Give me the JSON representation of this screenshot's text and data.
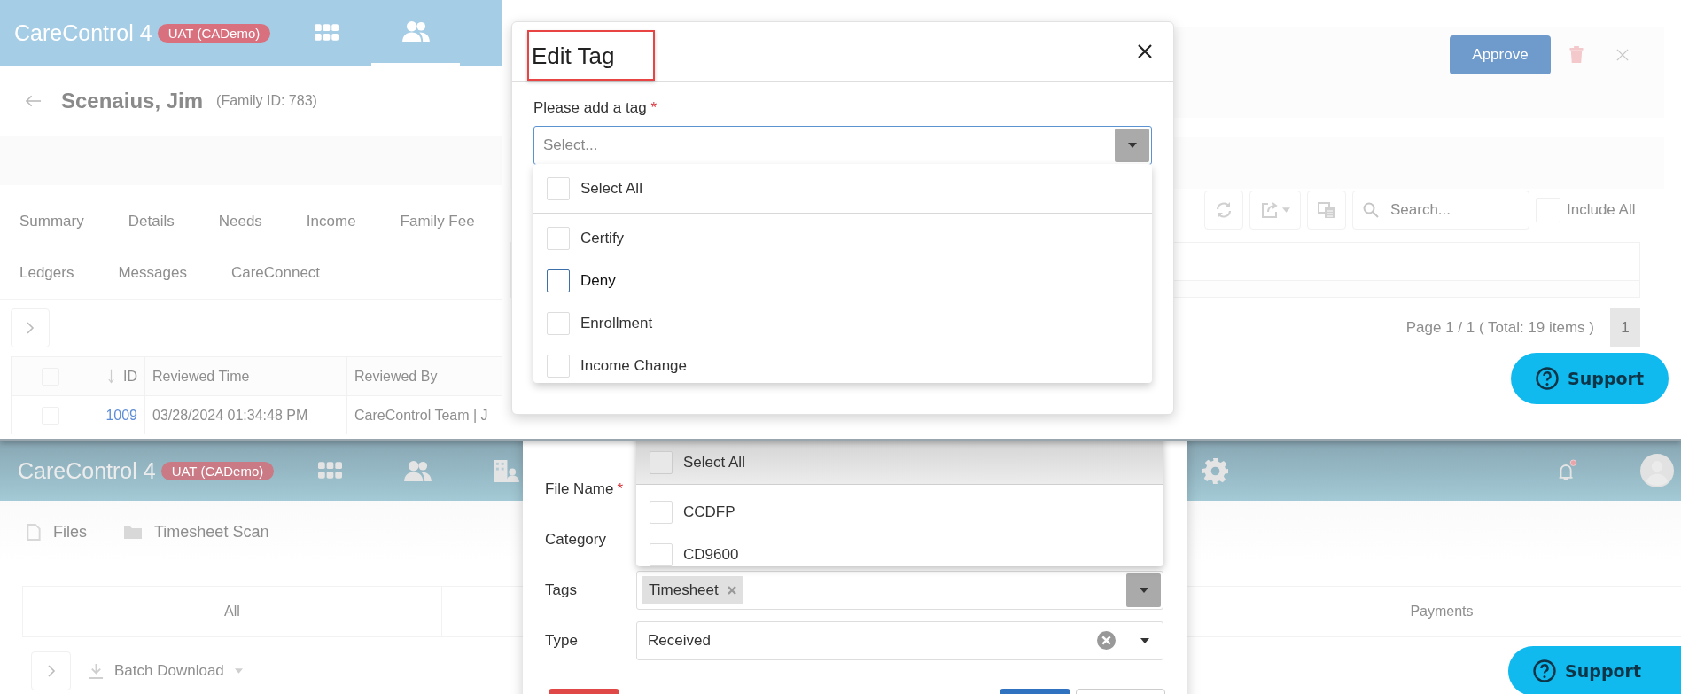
{
  "top_screen": {
    "app_bar": {
      "title": "CareControl 4",
      "environment": "UAT (CADemo)"
    },
    "person": {
      "name": "Scenaius, Jim",
      "family_id": "(Family ID: 783)"
    },
    "tab_rows": [
      [
        "Summary",
        "Details",
        "Needs",
        "Income",
        "Family Fee"
      ],
      [
        "Ledgers",
        "Messages",
        "CareConnect"
      ]
    ],
    "actions": {
      "approve": "Approve"
    },
    "toolbar": {
      "search_placeholder": "Search...",
      "include_all": {
        "label": "Include All",
        "checked": false
      }
    },
    "table": {
      "select_all_checked": false,
      "columns": [
        "ID",
        "Reviewed Time",
        "Reviewed By"
      ],
      "rows": [
        {
          "checked": false,
          "id": "1009",
          "reviewed_time": "03/28/2024 01:34:48 PM",
          "reviewed_by": "CareControl Team | J"
        }
      ]
    },
    "pager": {
      "summary": "Page 1 / 1 ( Total: 19 items )",
      "pages": [
        {
          "label": "1",
          "selected": true
        }
      ]
    },
    "support": {
      "label": "Support"
    },
    "dialog": {
      "title": "Edit Tag",
      "field": {
        "label": "Please add a tag",
        "required_mark": "*",
        "placeholder": "Select..."
      },
      "options": [
        {
          "label": "Select All",
          "kind": "select-all",
          "checked": false,
          "focused": false
        },
        {
          "label": "Certify",
          "kind": "option",
          "checked": false,
          "focused": false
        },
        {
          "label": "Deny",
          "kind": "option",
          "checked": false,
          "focused": true
        },
        {
          "label": "Enrollment",
          "kind": "option",
          "checked": false,
          "focused": false
        },
        {
          "label": "Income Change",
          "kind": "option",
          "checked": false,
          "focused": false
        }
      ]
    }
  },
  "bottom_screen": {
    "app_bar": {
      "title": "CareControl 4",
      "environment": "UAT (CADemo)"
    },
    "breadcrumb": [
      "Files",
      "Timesheet Scan"
    ],
    "tabs": [
      {
        "label": "All"
      },
      {
        "label": "Payments"
      }
    ],
    "batch_download": "Batch Download",
    "support": {
      "label": "Support"
    },
    "dialog": {
      "fields": [
        {
          "label": "File Name",
          "required_mark": "*",
          "kind": "text"
        },
        {
          "label": "Category",
          "kind": "text"
        },
        {
          "label": "Tags",
          "kind": "tags",
          "chips": [
            "Timesheet"
          ]
        },
        {
          "label": "Type",
          "kind": "select",
          "value": "Received"
        }
      ],
      "dropdown": [
        {
          "label": "Select All",
          "kind": "select-all",
          "checked": false
        },
        {
          "label": "CCDFP",
          "kind": "option",
          "checked": false
        },
        {
          "label": "CD9600",
          "kind": "option",
          "checked": false
        }
      ],
      "footer_buttons": [
        {
          "kind": "danger"
        },
        {
          "kind": "primary"
        },
        {
          "kind": "default"
        }
      ]
    }
  }
}
